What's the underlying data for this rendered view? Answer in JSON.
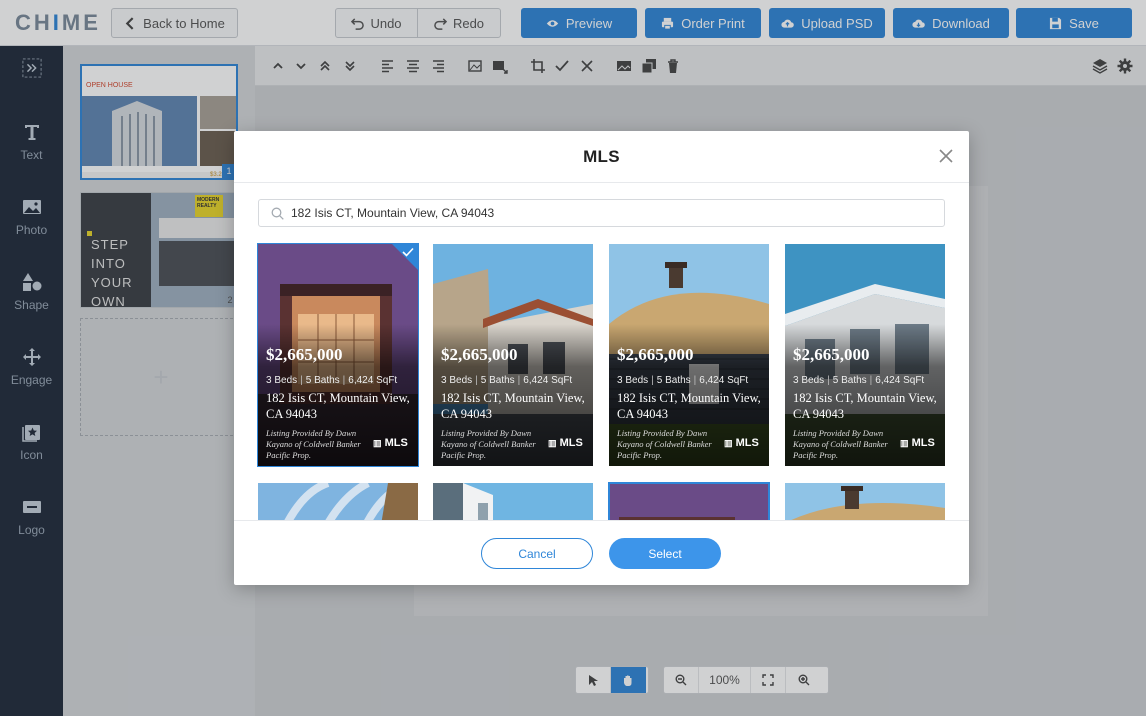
{
  "app": {
    "brand": "CHIME"
  },
  "topbar": {
    "back_label": "Back to Home",
    "undo_label": "Undo",
    "redo_label": "Redo",
    "preview_label": "Preview",
    "order_print_label": "Order Print",
    "upload_psd_label": "Upload PSD",
    "download_label": "Download",
    "save_label": "Save"
  },
  "leftnav": {
    "items": [
      {
        "label": "",
        "icon": "collapse-icon"
      },
      {
        "label": "Text",
        "icon": "text-icon"
      },
      {
        "label": "Photo",
        "icon": "photo-icon"
      },
      {
        "label": "Shape",
        "icon": "shape-icon"
      },
      {
        "label": "Engage",
        "icon": "engage-icon"
      },
      {
        "label": "Icon",
        "icon": "icon-icon"
      },
      {
        "label": "Logo",
        "icon": "logo-icon"
      }
    ]
  },
  "pages": {
    "thumbs": [
      {
        "number": "1",
        "title": "OPEN HOUSE",
        "price": "$3.2"
      },
      {
        "number": "2",
        "headline": "STEP INTO YOUR OWN SPACE",
        "tag": "MODERN REALTY"
      }
    ]
  },
  "workspace": {
    "zoom": "100%"
  },
  "modal": {
    "title": "MLS",
    "search": {
      "value": "182 Isis CT, Mountain View, CA 94043",
      "placeholder": ""
    },
    "listings": [
      {
        "price": "$2,665,000",
        "beds": "3 Beds",
        "baths": "5 Baths",
        "sqft": "6,424 SqFt",
        "address": "182 Isis CT, Mountain View, CA 94043",
        "provider": "Listing Provided By Dawn Kayano of Coldwell Banker Pacific Prop.",
        "mls": "MLS",
        "selected": true
      },
      {
        "price": "$2,665,000",
        "beds": "3 Beds",
        "baths": "5 Baths",
        "sqft": "6,424 SqFt",
        "address": "182 Isis CT, Mountain View, CA 94043",
        "provider": "Listing Provided By Dawn Kayano of Coldwell Banker Pacific Prop.",
        "mls": "MLS",
        "selected": false
      },
      {
        "price": "$2,665,000",
        "beds": "3 Beds",
        "baths": "5 Baths",
        "sqft": "6,424 SqFt",
        "address": "182 Isis CT, Mountain View, CA 94043",
        "provider": "Listing Provided By Dawn Kayano of Coldwell Banker Pacific Prop.",
        "mls": "MLS",
        "selected": false
      },
      {
        "price": "$2,665,000",
        "beds": "3 Beds",
        "baths": "5 Baths",
        "sqft": "6,424 SqFt",
        "address": "182 Isis CT, Mountain View, CA 94043",
        "provider": "Listing Provided By Dawn Kayano of Coldwell Banker Pacific Prop.",
        "mls": "MLS",
        "selected": false
      }
    ],
    "cancel_label": "Cancel",
    "select_label": "Select"
  },
  "colors": {
    "accent": "#2f86d8",
    "nav_bg": "#1f2a3a"
  }
}
